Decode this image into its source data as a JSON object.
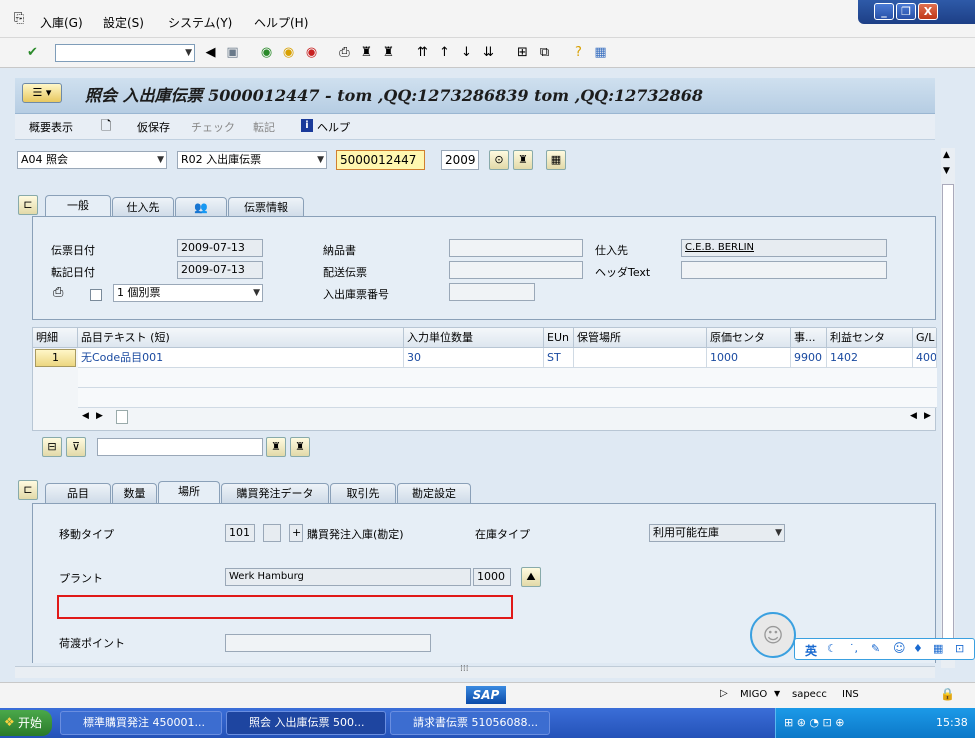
{
  "menubar": {
    "items": [
      "入庫(G)",
      "設定(S)",
      "システム(Y)",
      "ヘルプ(H)"
    ]
  },
  "window_controls": {
    "minimize": "_",
    "restore": "❐",
    "close": "X"
  },
  "std_toolbar": {
    "command_field_value": ""
  },
  "title": "照会 入出庫伝票 5000012447 - tom ,QQ:1273286839 tom ,QQ:12732868",
  "app_toolbar": {
    "overview": "概要表示",
    "hold": "仮保存",
    "check": "チェック",
    "post": "転記",
    "help": "ヘルプ"
  },
  "header": {
    "action": "A04 照会",
    "reference": "R02 入出庫伝票",
    "doc_number": "5000012447",
    "year": "2009"
  },
  "doc_tabs": [
    "一般",
    "仕入先",
    "",
    "伝票情報"
  ],
  "general": {
    "doc_date_label": "伝票日付",
    "doc_date": "2009-07-13",
    "post_date_label": "転記日付",
    "post_date": "2009-07-13",
    "delivery_note_label": "納品書",
    "delivery_note": "",
    "shipping_label": "配送伝票",
    "shipping": "",
    "slip_no_label": "入出庫票番号",
    "slip_no": "",
    "vendor_label": "仕入先",
    "vendor": "C.E.B. BERLIN",
    "header_text_label": "ヘッダText",
    "header_text": "",
    "print_version": "1 個別票"
  },
  "grid": {
    "columns": [
      "明細",
      "品目テキスト (短)",
      "入力単位数量",
      "EUn",
      "保管場所",
      "原価センタ",
      "事...",
      "利益センタ",
      "G/L"
    ],
    "rows": [
      [
        "1",
        "无Code品目001",
        "30",
        "ST",
        "",
        "1000",
        "9900",
        "1402",
        "400"
      ]
    ]
  },
  "item_tabs": [
    "品目",
    "数量",
    "場所",
    "購買発注データ",
    "取引先",
    "勘定設定"
  ],
  "item_detail": {
    "movement_type_label": "移動タイプ",
    "movement_type": "101",
    "movement_special": "",
    "movement_plus": "+",
    "movement_text": "購買発注入庫(勘定)",
    "stock_type_label": "在庫タイプ",
    "stock_type": "利用可能在庫",
    "plant_label": "プラント",
    "plant_name": "Werk Hamburg",
    "plant_code": "1000",
    "unloading_label": "荷渡ポイント",
    "unloading": ""
  },
  "status": {
    "transaction": "MIGO",
    "server": "sapecc",
    "mode": "INS"
  },
  "taskbar": {
    "start": "开始",
    "tasks": [
      "標準購買発注 450001...",
      "照会 入出庫伝票 500...",
      "請求書伝票 51056088..."
    ],
    "clock": "15:38"
  },
  "ime": {
    "label": "英"
  }
}
